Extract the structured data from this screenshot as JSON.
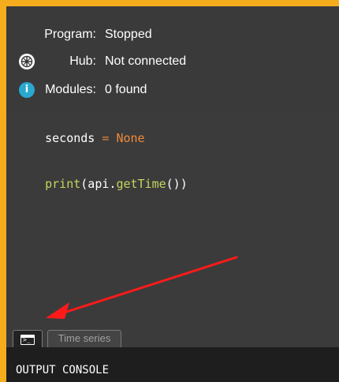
{
  "colors": {
    "background_orange": "#f6ad1d",
    "panel": "#3a3a3a",
    "editor": "#3b3b3b",
    "console": "#1e1e1e",
    "arrow": "#ff1a1a",
    "info_blue": "#29a9cf"
  },
  "status": {
    "program": {
      "label": "Program:",
      "value": "Stopped"
    },
    "hub": {
      "label": "Hub:",
      "value": "Not connected",
      "icon": "hub-icon"
    },
    "modules": {
      "label": "Modules:",
      "value": "0 found",
      "icon": "info-icon",
      "icon_glyph": "i"
    }
  },
  "editor": {
    "lines": [
      {
        "tokens": [
          {
            "text": "seconds",
            "type": "default"
          },
          {
            "text": " = ",
            "type": "operator"
          },
          {
            "text": "None",
            "type": "keyword"
          }
        ]
      },
      {
        "tokens": [
          {
            "text": "print",
            "type": "function"
          },
          {
            "text": "(api.",
            "type": "default"
          },
          {
            "text": "getTime",
            "type": "method"
          },
          {
            "text": "())",
            "type": "default"
          }
        ]
      }
    ]
  },
  "tabs": {
    "console_tab_icon": "console-icon",
    "time_series_label": "Time series"
  },
  "output": {
    "title": "OUTPUT CONSOLE"
  }
}
